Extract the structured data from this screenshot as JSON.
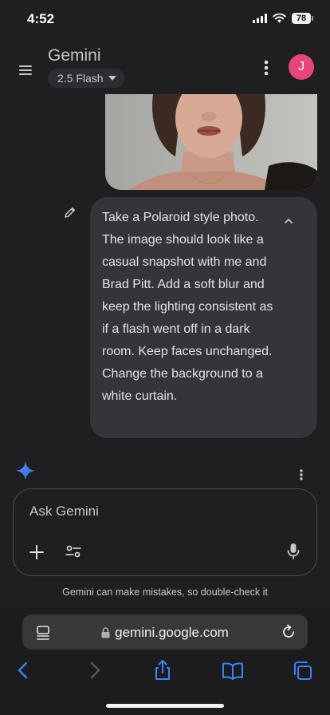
{
  "status_bar": {
    "time": "4:52",
    "battery": "78"
  },
  "header": {
    "title": "Gemini",
    "model": "2.5 Flash",
    "avatar_initial": "J"
  },
  "chat": {
    "prompt_text": "Take a Polaroid style photo. The image should look like a casual snapshot with me and Brad Pitt. Add a soft blur and keep the lighting consistent as if a flash went off in a dark room. Keep faces unchanged. Change the background to a white curtain."
  },
  "input": {
    "placeholder": "Ask Gemini",
    "value": ""
  },
  "disclaimer": "Gemini can make mistakes, so double-check it",
  "browser": {
    "url": "gemini.google.com"
  },
  "colors": {
    "accent": "#4285f4",
    "avatar": "#e8467b",
    "background": "#1f1f22",
    "bubble": "#333538"
  }
}
